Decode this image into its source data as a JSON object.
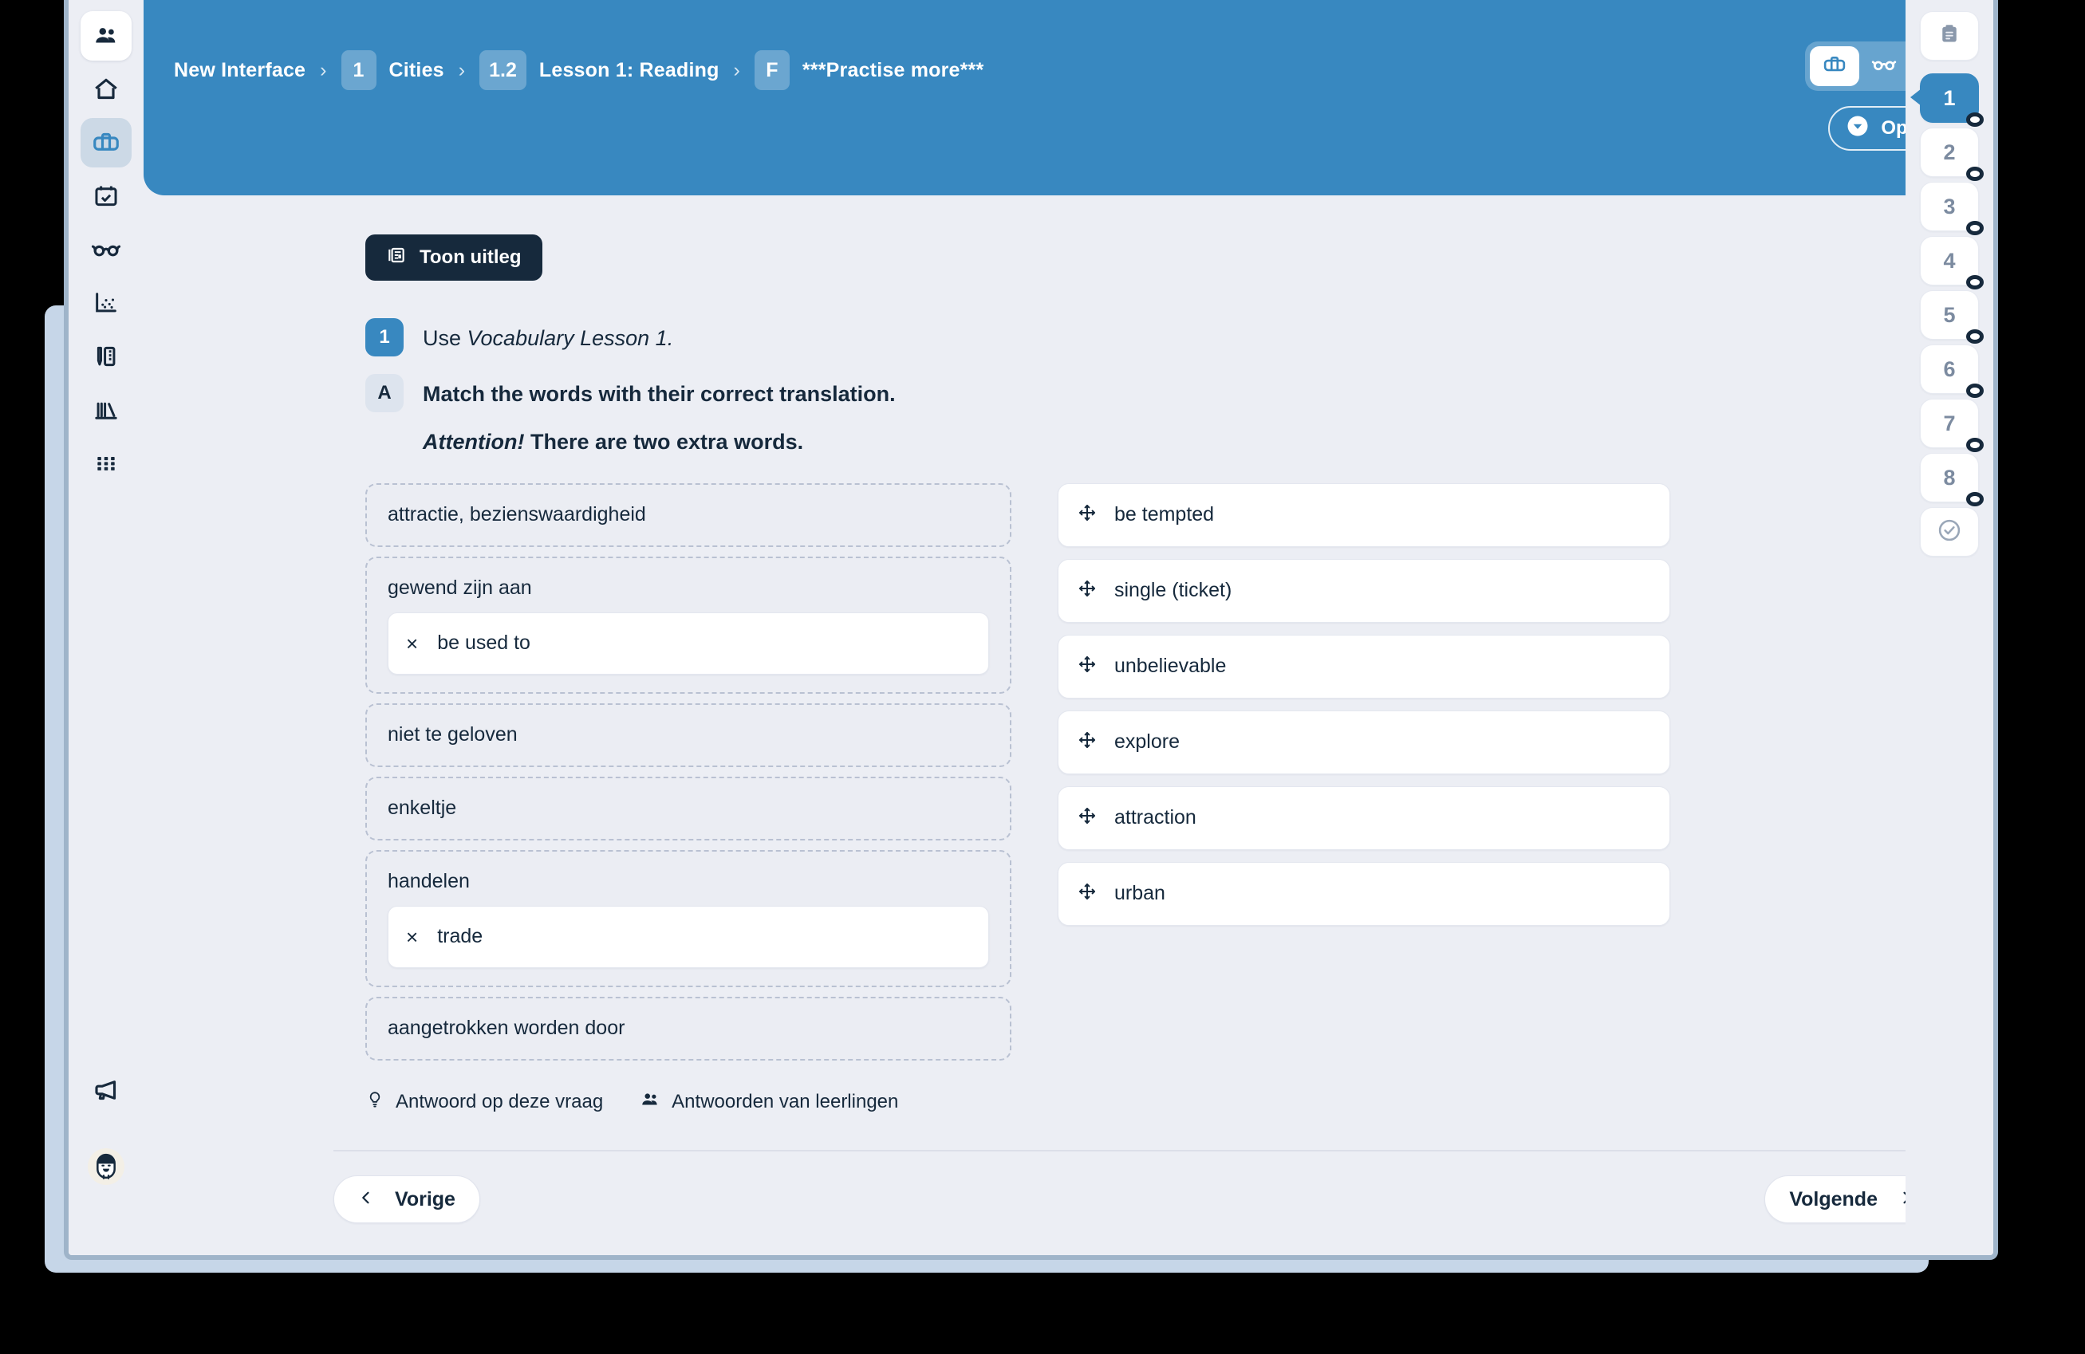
{
  "colors": {
    "header_blue": "#3888c0",
    "dark_navy": "#16293c",
    "page_bg": "#eceef4",
    "dropzone_bg": "#ebedf3",
    "dashed_border": "#b9c1d2"
  },
  "sidebar": {
    "top_items": [
      {
        "name": "users-icon",
        "label": "Klassen"
      },
      {
        "name": "home-icon",
        "label": "Home"
      },
      {
        "name": "briefcase-icon",
        "label": "Lesmateriaal"
      },
      {
        "name": "calendar-check-icon",
        "label": "Planning"
      },
      {
        "name": "glasses-icon",
        "label": "Nakijken"
      },
      {
        "name": "scatter-chart-icon",
        "label": "Resultaten"
      },
      {
        "name": "pencil-ruler-icon",
        "label": "Maken"
      },
      {
        "name": "books-icon",
        "label": "Bibliotheek"
      },
      {
        "name": "grid-icon",
        "label": "Apps"
      }
    ],
    "bottom_items": [
      {
        "name": "megaphone-icon",
        "label": "Nieuws"
      },
      {
        "name": "avatar",
        "label": "Profiel"
      }
    ]
  },
  "header": {
    "breadcrumb": [
      {
        "chip": "",
        "label": "New Interface"
      },
      {
        "chip": "1",
        "label": "Cities"
      },
      {
        "chip": "1.2",
        "label": "Lesson 1: Reading"
      },
      {
        "chip": "F",
        "label": "***Practise more***"
      }
    ],
    "separator": "›",
    "modes": [
      {
        "name": "briefcase-icon",
        "selected": true
      },
      {
        "name": "glasses-icon",
        "selected": false
      },
      {
        "name": "pencil-ruler-icon",
        "selected": false
      }
    ],
    "options_button": "Opties"
  },
  "main": {
    "explain_button": "Toon uitleg",
    "question_number": "1",
    "question_intro_prefix": "Use ",
    "question_intro_italic": "Vocabulary Lesson 1.",
    "sub_letter": "A",
    "sub_instruction": "Match the words with their correct translation.",
    "attention_italic": "Attention!",
    "attention_rest": " There are two extra words.",
    "drop_zones": [
      {
        "label": "attractie, bezienswaardigheid",
        "placed": null
      },
      {
        "label": "gewend zijn aan",
        "placed": "be used to"
      },
      {
        "label": "niet te geloven",
        "placed": null
      },
      {
        "label": "enkeltje",
        "placed": null
      },
      {
        "label": "handelen",
        "placed": "trade"
      },
      {
        "label": "aangetrokken worden door",
        "placed": null
      }
    ],
    "word_chips": [
      "be tempted",
      "single (ticket)",
      "unbelievable",
      "explore",
      "attraction",
      "urban"
    ],
    "remove_symbol": "×",
    "actions": [
      {
        "icon": "lightbulb-icon",
        "label": "Antwoord op deze vraag"
      },
      {
        "icon": "students-icon",
        "label": "Antwoorden van leerlingen"
      }
    ]
  },
  "footer": {
    "prev_label": "Vorige",
    "next_label": "Volgende"
  },
  "rail": {
    "top_icon": "clipboard-icon",
    "steps": [
      {
        "label": "1",
        "active": true
      },
      {
        "label": "2",
        "active": false
      },
      {
        "label": "3",
        "active": false
      },
      {
        "label": "4",
        "active": false
      },
      {
        "label": "5",
        "active": false
      },
      {
        "label": "6",
        "active": false
      },
      {
        "label": "7",
        "active": false
      },
      {
        "label": "8",
        "active": false
      }
    ],
    "bottom_icon": "check-circle-icon"
  }
}
